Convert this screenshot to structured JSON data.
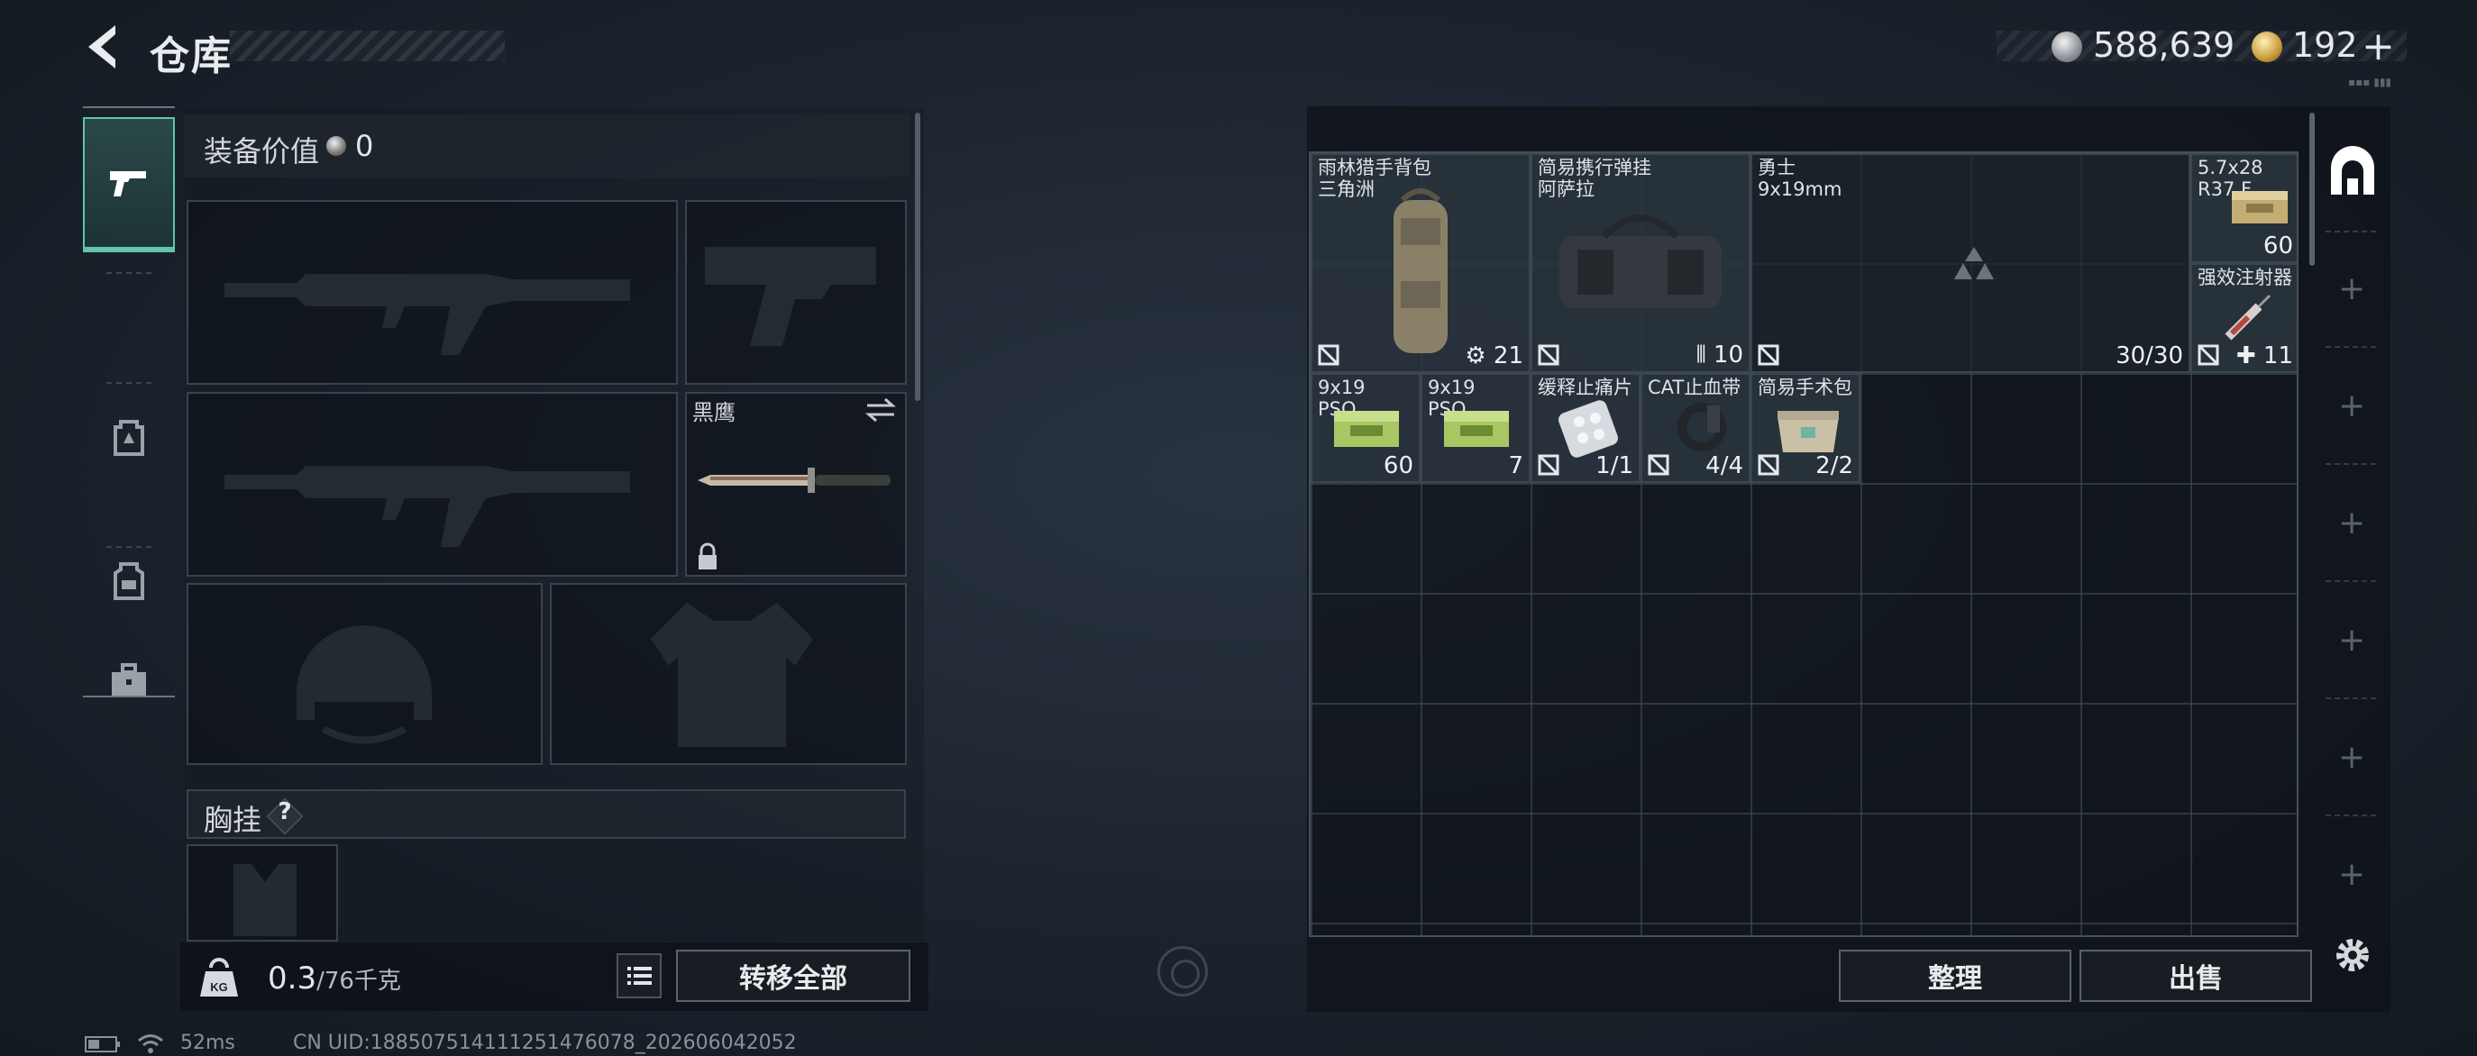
{
  "header": {
    "title": "仓库",
    "back_icon": "back-arrow-icon",
    "currency": {
      "silver_amount": "588,639",
      "gold_amount": "192",
      "topup_label": "+"
    }
  },
  "category_tabs": [
    {
      "icon": "pistol-icon",
      "active": true
    },
    {
      "icon": "backpack-icon",
      "active": false
    },
    {
      "icon": "vest-icon",
      "active": false
    },
    {
      "icon": "toolbox-icon",
      "active": false
    }
  ],
  "loadout": {
    "value_label": "装备价值",
    "value_amount": "0",
    "knife_name": "黑鹰",
    "chest_label": "胸挂",
    "chest_help": "?",
    "weight_value": "0.3",
    "weight_unit": "/76千克",
    "transfer_all_label": "转移全部"
  },
  "storage": {
    "items": [
      {
        "name": "雨林猎手背包",
        "sub": "三角洲",
        "count": "21",
        "icon": "backpack-item-icon"
      },
      {
        "name": "简易携行弹挂",
        "sub": "阿萨拉",
        "count": "10",
        "icon": "chest-rig-item-icon"
      },
      {
        "name": "勇士",
        "sub": "9x19mm",
        "count": "30/30",
        "icon": "smg-item-icon"
      },
      {
        "name": "5.7x28",
        "sub": "R37.F",
        "count": "60",
        "icon": "ammo-box-icon"
      },
      {
        "name": "强效注射器",
        "sub": "",
        "count": "11",
        "icon": "syringe-icon"
      },
      {
        "name": "9x19",
        "sub": "PSO",
        "count": "60",
        "icon": "ammo-box-icon"
      },
      {
        "name": "9x19",
        "sub": "PSO",
        "count": "7",
        "icon": "ammo-box-icon"
      },
      {
        "name": "缓释止痛片",
        "sub": "",
        "count": "1/1",
        "icon": "pills-icon"
      },
      {
        "name": "CAT止血带",
        "sub": "",
        "count": "4/4",
        "icon": "tourniquet-icon"
      },
      {
        "name": "简易手术包",
        "sub": "",
        "count": "2/2",
        "icon": "surgery-kit-icon"
      }
    ],
    "sort_label": "整理",
    "sell_label": "出售"
  },
  "status": {
    "ping": "52ms",
    "uid": "CN UID:1885075141112514760​78_202606042052"
  },
  "colors": {
    "accent": "#61c4a7",
    "panel": "#0e1217"
  }
}
